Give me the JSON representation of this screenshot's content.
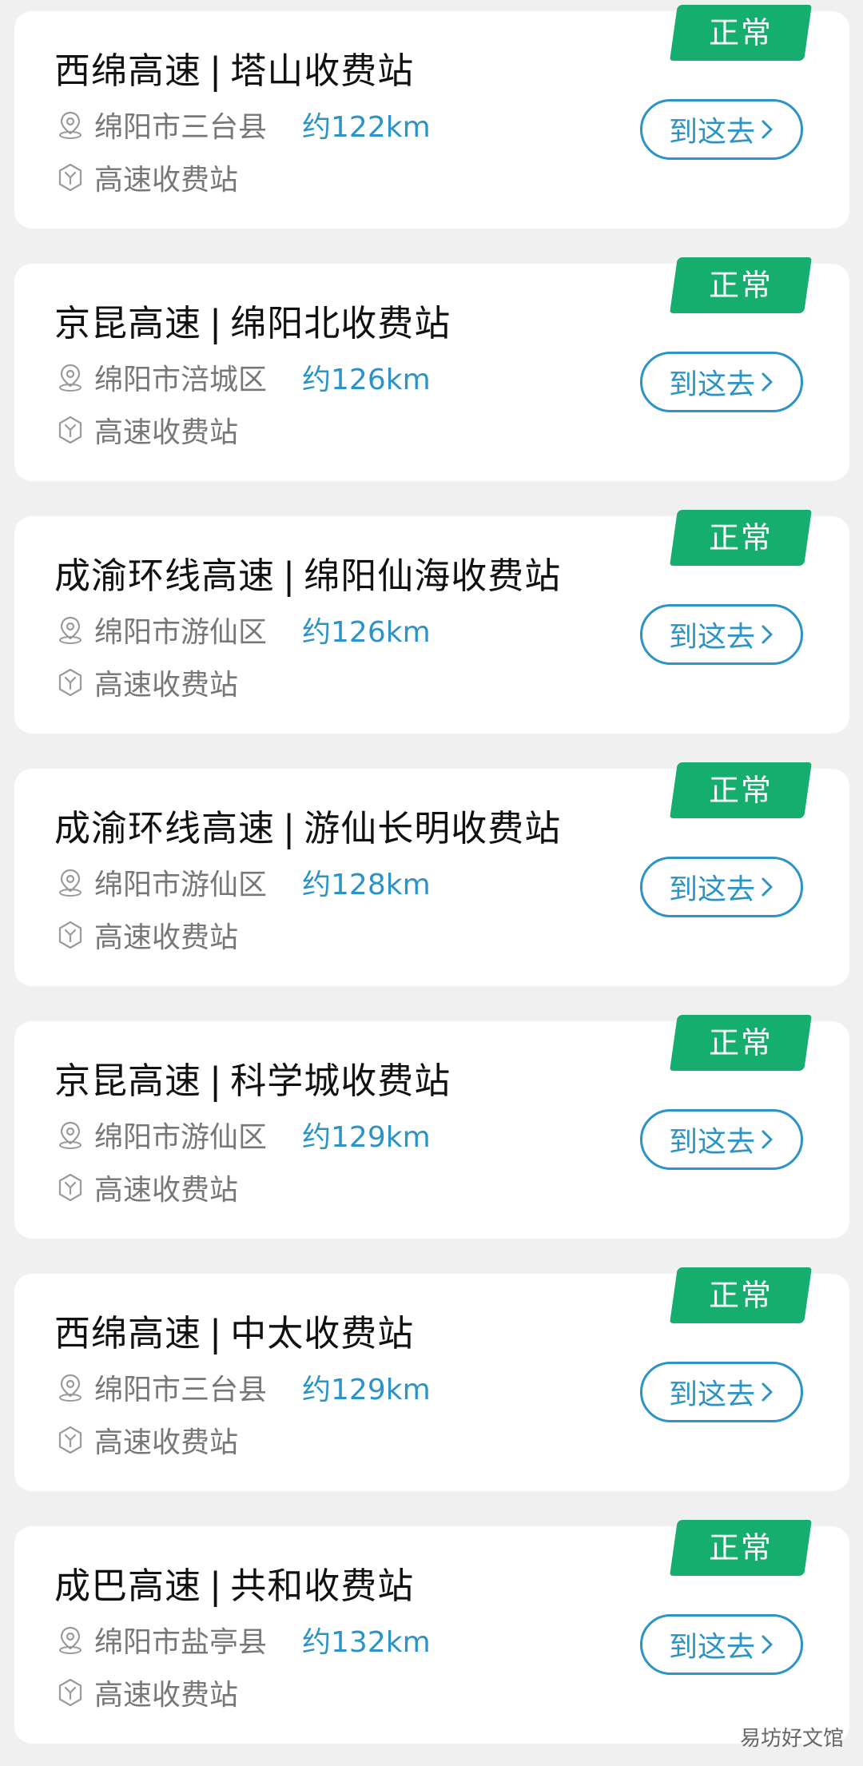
{
  "stations": [
    {
      "highway": "西绵高速",
      "station": "塔山收费站",
      "location": "绵阳市三台县",
      "distance": "约122km",
      "type": "高速收费站",
      "status": "正常",
      "action": "到这去"
    },
    {
      "highway": "京昆高速",
      "station": "绵阳北收费站",
      "location": "绵阳市涪城区",
      "distance": "约126km",
      "type": "高速收费站",
      "status": "正常",
      "action": "到这去"
    },
    {
      "highway": "成渝环线高速",
      "station": "绵阳仙海收费站",
      "location": "绵阳市游仙区",
      "distance": "约126km",
      "type": "高速收费站",
      "status": "正常",
      "action": "到这去"
    },
    {
      "highway": "成渝环线高速",
      "station": "游仙长明收费站",
      "location": "绵阳市游仙区",
      "distance": "约128km",
      "type": "高速收费站",
      "status": "正常",
      "action": "到这去"
    },
    {
      "highway": "京昆高速",
      "station": "科学城收费站",
      "location": "绵阳市游仙区",
      "distance": "约129km",
      "type": "高速收费站",
      "status": "正常",
      "action": "到这去"
    },
    {
      "highway": "西绵高速",
      "station": "中太收费站",
      "location": "绵阳市三台县",
      "distance": "约129km",
      "type": "高速收费站",
      "status": "正常",
      "action": "到这去"
    },
    {
      "highway": "成巴高速",
      "station": "共和收费站",
      "location": "绵阳市盐亭县",
      "distance": "约132km",
      "type": "高速收费站",
      "status": "正常",
      "action": "到这去"
    }
  ],
  "title_separator": "|",
  "watermark": "易坊好文馆",
  "icons": {
    "location": "location-pin-icon",
    "type": "toll-station-icon",
    "action": "chevron-right-icon"
  },
  "colors": {
    "status_green": "#16ae6e",
    "accent_blue": "#2b93c6",
    "title_text": "#111111",
    "secondary_text": "#777777",
    "background": "#f0f0f0"
  }
}
